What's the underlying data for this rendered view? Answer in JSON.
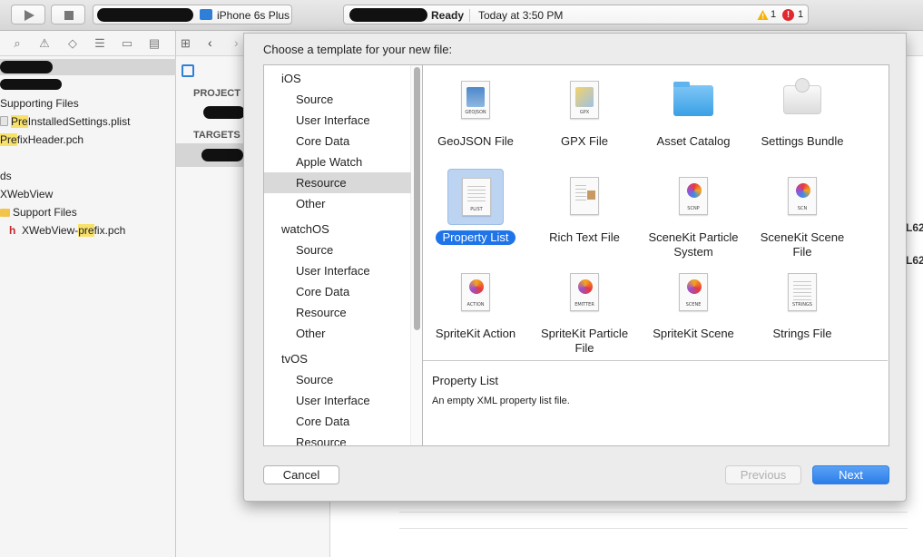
{
  "toolbar": {
    "device_label": "iPhone 6s Plus",
    "status_text": "Ready",
    "status_time": "Today at 3:50 PM",
    "warning_count": "1",
    "error_count": "1"
  },
  "navigator": {
    "rows": [
      {
        "label": "Supporting Files"
      },
      {
        "label_hl": "Pre",
        "label_rest": "InstalledSettings.plist"
      },
      {
        "label_hl": "Pre",
        "label_rest": "fixHeader.pch"
      },
      {
        "label": "ds"
      },
      {
        "label": "XWebView"
      },
      {
        "label": "Support Files"
      },
      {
        "label_pre": "XWebView-",
        "label_hl": "pre",
        "label_rest": "fix.pch"
      }
    ]
  },
  "editor": {
    "project_header": "PROJECT",
    "targets_header": "TARGETS",
    "right_text_1": "L62",
    "right_text_2": "L62"
  },
  "sheet": {
    "title": "Choose a template for your new file:",
    "categories": [
      {
        "label": "iOS",
        "kind": "platform"
      },
      {
        "label": "Source",
        "kind": "sub"
      },
      {
        "label": "User Interface",
        "kind": "sub"
      },
      {
        "label": "Core Data",
        "kind": "sub"
      },
      {
        "label": "Apple Watch",
        "kind": "sub"
      },
      {
        "label": "Resource",
        "kind": "sub",
        "selected": true
      },
      {
        "label": "Other",
        "kind": "sub"
      },
      {
        "label": "watchOS",
        "kind": "platform"
      },
      {
        "label": "Source",
        "kind": "sub"
      },
      {
        "label": "User Interface",
        "kind": "sub"
      },
      {
        "label": "Core Data",
        "kind": "sub"
      },
      {
        "label": "Resource",
        "kind": "sub"
      },
      {
        "label": "Other",
        "kind": "sub"
      },
      {
        "label": "tvOS",
        "kind": "platform"
      },
      {
        "label": "Source",
        "kind": "sub"
      },
      {
        "label": "User Interface",
        "kind": "sub"
      },
      {
        "label": "Core Data",
        "kind": "sub"
      },
      {
        "label": "Resource",
        "kind": "sub"
      }
    ],
    "templates": [
      {
        "label": "GeoJSON File",
        "icon": "geojson-file-icon",
        "tag": "GEOJSON"
      },
      {
        "label": "GPX File",
        "icon": "gpx-file-icon",
        "tag": "GPX"
      },
      {
        "label": "Asset Catalog",
        "icon": "asset-catalog-icon"
      },
      {
        "label": "Settings Bundle",
        "icon": "settings-bundle-icon"
      },
      {
        "label": "Property List",
        "icon": "property-list-icon",
        "tag": "PLIST",
        "selected": true
      },
      {
        "label": "Rich Text File",
        "icon": "rich-text-file-icon"
      },
      {
        "label": "SceneKit Particle System",
        "icon": "scenekit-particle-icon",
        "tag": "SCNP"
      },
      {
        "label": "SceneKit Scene File",
        "icon": "scenekit-scene-icon",
        "tag": "SCN"
      },
      {
        "label": "SpriteKit Action",
        "icon": "spritekit-action-icon",
        "tag": "ACTION"
      },
      {
        "label": "SpriteKit Particle File",
        "icon": "spritekit-particle-icon",
        "tag": "EMITTER"
      },
      {
        "label": "SpriteKit Scene",
        "icon": "spritekit-scene-icon",
        "tag": "SCENE"
      },
      {
        "label": "Strings File",
        "icon": "strings-file-icon",
        "tag": "STRINGS"
      }
    ],
    "description_title": "Property List",
    "description_text": "An empty XML property list file.",
    "cancel_label": "Cancel",
    "previous_label": "Previous",
    "next_label": "Next"
  },
  "colors": {
    "accent": "#1e74e8",
    "selection": "#bcd3f2",
    "highlight": "#f7e06b",
    "error": "#e0282e",
    "warning": "#f5b400"
  }
}
